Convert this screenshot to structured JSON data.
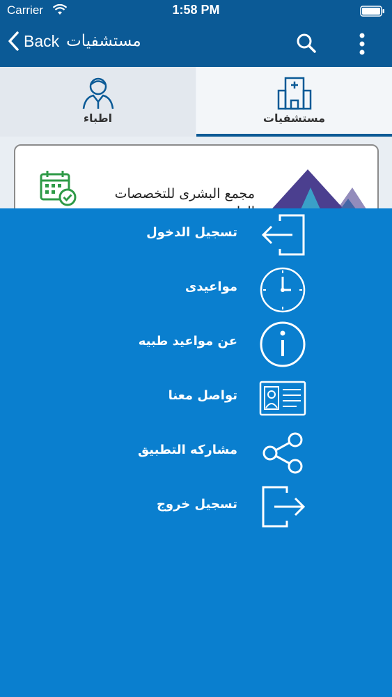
{
  "status_bar": {
    "carrier": "Carrier",
    "time": "1:58 PM"
  },
  "nav_bar": {
    "back_label": "Back",
    "title": "مستشفيات"
  },
  "tabs": [
    {
      "label": "اطباء",
      "icon": "doctor-icon"
    },
    {
      "label": "مستشفيات",
      "icon": "hospital-icon",
      "selected": true
    }
  ],
  "card": {
    "title": "مجمع البشرى للتخصصات الطبية"
  },
  "menu": [
    {
      "label": "تسجيل الدخول",
      "icon": "login-icon"
    },
    {
      "label": "مواعيدى",
      "icon": "clock-icon"
    },
    {
      "label": "عن مواعيد طبيه",
      "icon": "info-icon"
    },
    {
      "label": "تواصل معنا",
      "icon": "contact-card-icon"
    },
    {
      "label": "مشاركه التطبيق",
      "icon": "share-icon"
    },
    {
      "label": "تسجيل خروج",
      "icon": "logout-icon"
    }
  ],
  "colors": {
    "nav": "#0b5a96",
    "drawer": "#0a7fcf",
    "accent_green": "#2e9a47"
  }
}
